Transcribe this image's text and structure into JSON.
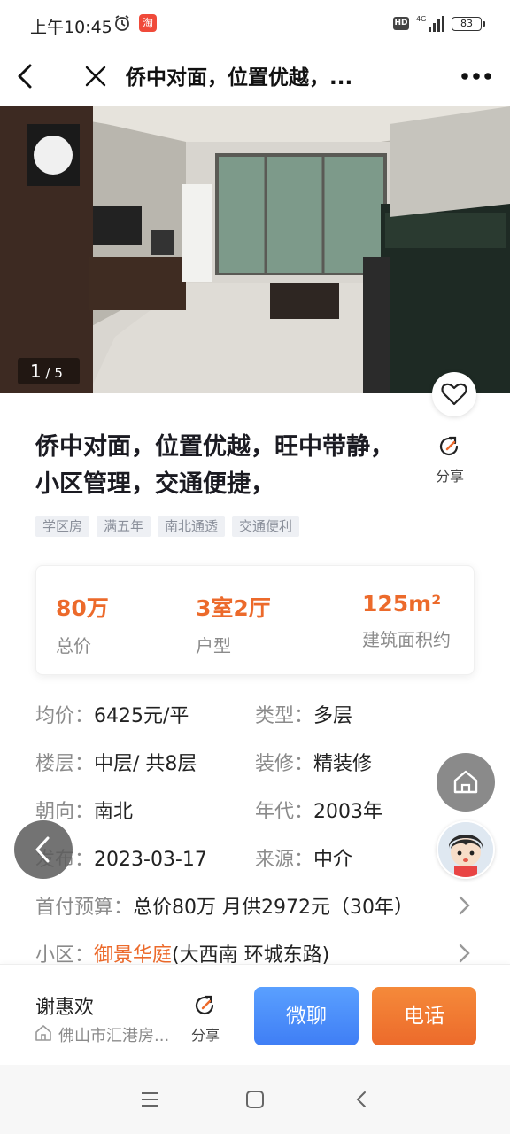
{
  "status_bar": {
    "time": "上午10:45",
    "hd": "HD",
    "network": "4G",
    "battery": "83",
    "app_icon_text": "淘"
  },
  "nav": {
    "title": "侨中对面，位置优越，..."
  },
  "photo": {
    "current": "1",
    "total": "5"
  },
  "listing": {
    "title": "侨中对面，位置优越，旺中带静，小区管理，交通便捷，",
    "share_label": "分享",
    "tags": [
      "学区房",
      "满五年",
      "南北通透",
      "交通便利"
    ]
  },
  "stats": [
    {
      "value": "80万",
      "label": "总价"
    },
    {
      "value": "3室2厅",
      "label": "户型"
    },
    {
      "value": "125m²",
      "label": "建筑面积约"
    }
  ],
  "info": {
    "unit_price_k": "均价：",
    "unit_price_v": "6425元/平",
    "type_k": "类型：",
    "type_v": "多层",
    "floor_k": "楼层：",
    "floor_v": "中层/ 共8层",
    "decor_k": "装修：",
    "decor_v": "精装修",
    "orient_k": "朝向：",
    "orient_v": "南北",
    "year_k": "年代：",
    "year_v": "2003年",
    "pub_k": "发布：",
    "pub_v": "2023-03-17",
    "source_k": "来源：",
    "source_v": "中介",
    "budget_k": "首付预算：",
    "budget_v": "总价80万 月供2972元（30年）",
    "community_k": "小区：",
    "community_name": "御景华庭",
    "community_addr": "(大西南 环城东路)"
  },
  "bottom": {
    "agent_name": "谢惠欢",
    "agent_company": "佛山市汇港房...",
    "share_label": "分享",
    "chat_label": "微聊",
    "call_label": "电话"
  },
  "colors": {
    "accent_orange": "#ec6a2b",
    "accent_blue": "#3f7ef5"
  }
}
